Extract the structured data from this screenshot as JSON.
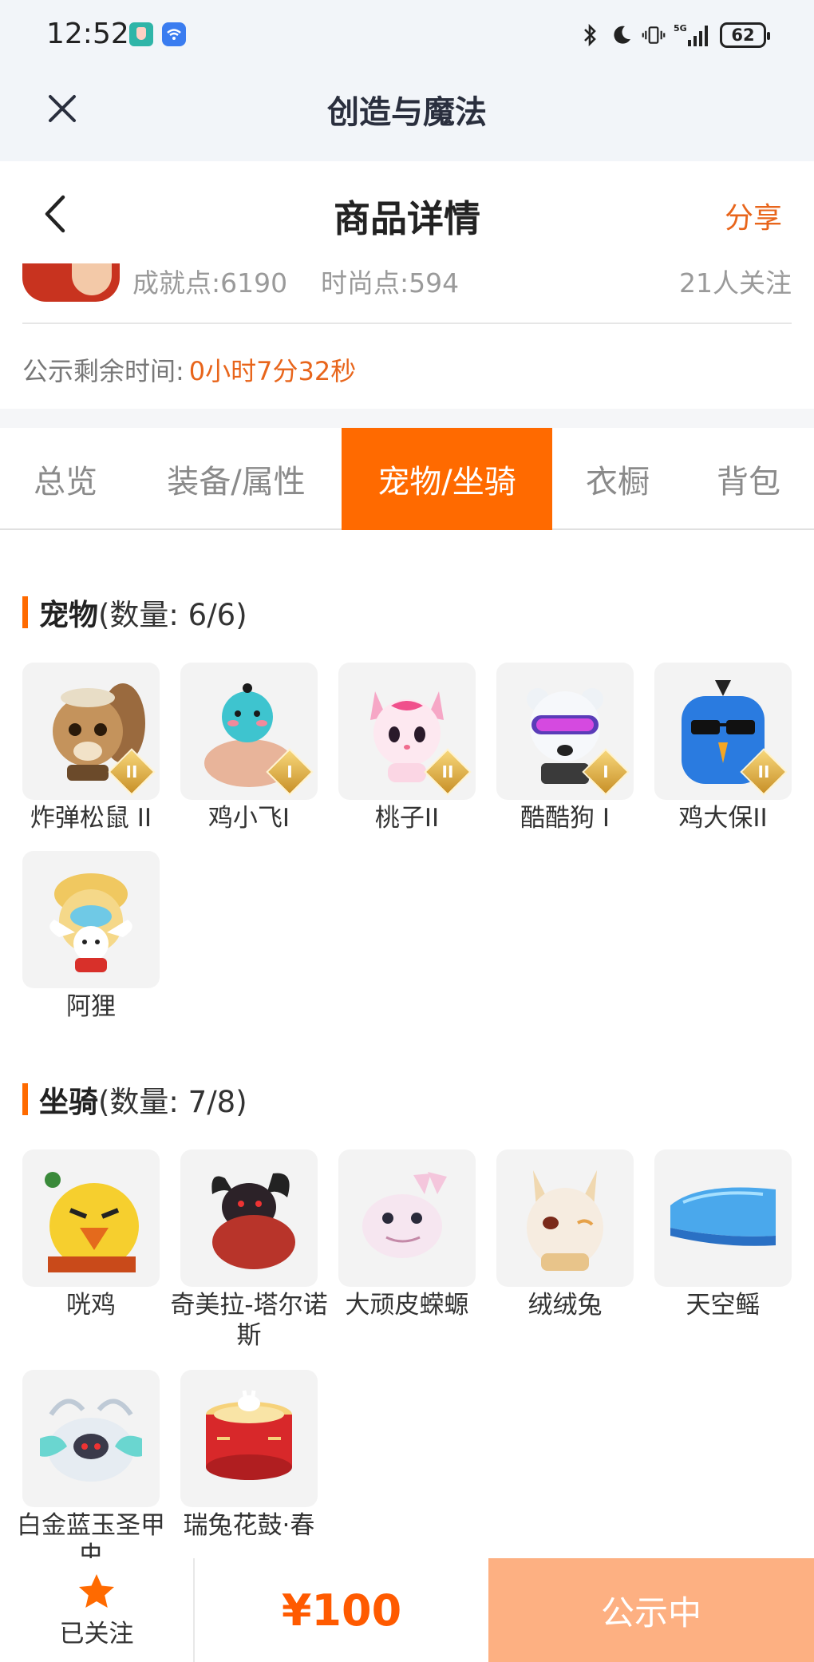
{
  "status_bar": {
    "time": "12:52",
    "battery": "62",
    "network": "5G"
  },
  "app_header": {
    "title": "创造与魔法"
  },
  "page_header": {
    "title": "商品详情",
    "share_label": "分享"
  },
  "profile": {
    "achievement_points": "成就点:6190",
    "fashion_points": "时尚点:594",
    "follow_count": "21人关注"
  },
  "countdown": {
    "label": "公示剩余时间:",
    "value": "0小时7分32秒"
  },
  "tabs": [
    {
      "label": "总览",
      "active": false
    },
    {
      "label": "装备/属性",
      "active": false
    },
    {
      "label": "宠物/坐骑",
      "active": true
    },
    {
      "label": "衣橱",
      "active": false
    },
    {
      "label": "背包",
      "active": false
    }
  ],
  "pets": {
    "title": "宠物",
    "count": "(数量: 6/6)",
    "items": [
      {
        "name": "炸弹松鼠 II",
        "grade": "II",
        "icon": "squirrel-pet-icon"
      },
      {
        "name": "鸡小飞I",
        "grade": "I",
        "icon": "blue-bird-pet-icon"
      },
      {
        "name": "桃子II",
        "grade": "II",
        "icon": "pink-cat-pet-icon"
      },
      {
        "name": "酷酷狗 I",
        "grade": "I",
        "icon": "cool-dog-pet-icon"
      },
      {
        "name": "鸡大保II",
        "grade": "II",
        "icon": "sunglasses-bird-pet-icon"
      },
      {
        "name": "阿狸",
        "grade": "",
        "icon": "lion-hat-pet-icon"
      }
    ]
  },
  "mounts": {
    "title": "坐骑",
    "count": "(数量: 7/8)",
    "items": [
      {
        "name": "咣鸡",
        "icon": "yellow-chicken-mount-icon"
      },
      {
        "name": "奇美拉-塔尔诺斯",
        "icon": "chimera-mount-icon"
      },
      {
        "name": "大顽皮蝾螈",
        "icon": "axolotl-mount-icon"
      },
      {
        "name": "绒绒兔",
        "icon": "fluffy-rabbit-mount-icon"
      },
      {
        "name": "天空鳐",
        "icon": "sky-ray-mount-icon"
      },
      {
        "name": "白金蓝玉圣甲虫",
        "icon": "scarab-mount-icon"
      },
      {
        "name": "瑞兔花鼓·春",
        "icon": "rabbit-drum-mount-icon"
      }
    ]
  },
  "bottom_bar": {
    "follow_label": "已关注",
    "price": "¥100",
    "status_label": "公示中"
  },
  "colors": {
    "accent": "#ff6a00",
    "accent_text": "#e8651b",
    "status_button": "#fdb082"
  }
}
